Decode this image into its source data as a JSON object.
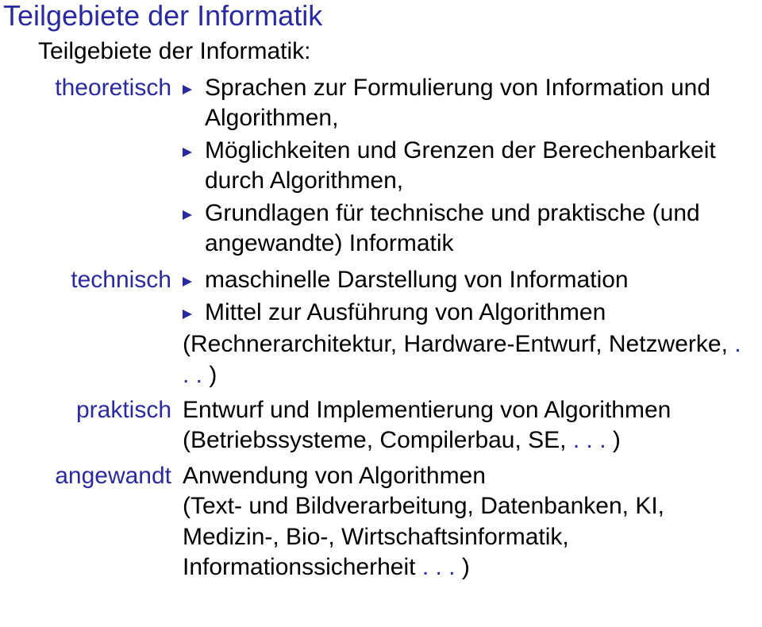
{
  "title": "Teilgebiete der Informatik",
  "subtitle": "Teilgebiete der Informatik:",
  "ellipsis": ". . .",
  "entries": [
    {
      "label": "theoretisch",
      "bullets": [
        "Sprachen zur Formulierung von Information und Algorithmen,",
        "Möglichkeiten und Grenzen der Berechenbarkeit durch Algorithmen,",
        "Grundlagen für technische und praktische (und angewandte) Informatik"
      ]
    },
    {
      "label": "technisch",
      "bullets": [
        "maschinelle Darstellung von Information",
        "Mittel zur Ausführung von Algorithmen"
      ],
      "paren_pre": "(Rechnerarchitektur, Hardware-Entwurf, Netzwerke, ",
      "paren_post": " )"
    },
    {
      "label": "praktisch",
      "text_pre": "Entwurf und Implementierung von Algorithmen (Betriebssysteme, Compilerbau, SE, ",
      "text_post": " )"
    },
    {
      "label": "angewandt",
      "text_pre": "Anwendung von Algorithmen",
      "sub_pre": "(Text- und Bildverarbeitung, Datenbanken, KI, Medizin-, Bio-, Wirtschaftsinformatik, Informationssicherheit ",
      "sub_post": " )"
    }
  ]
}
